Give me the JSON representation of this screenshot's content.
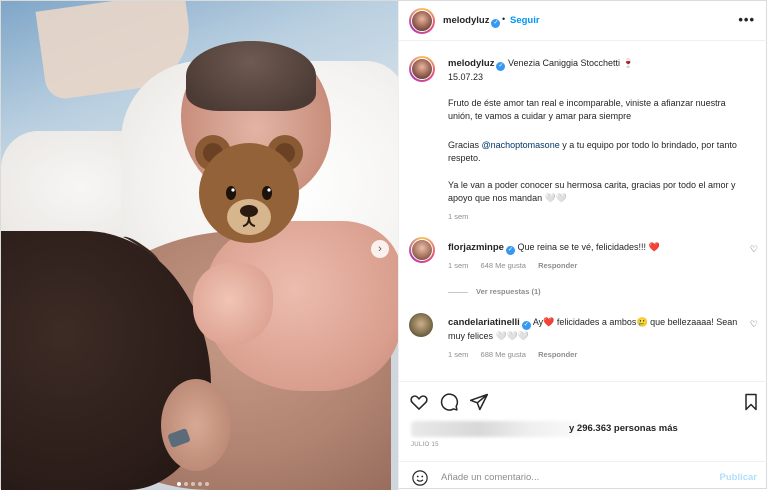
{
  "header": {
    "username": "melodyluz",
    "follow_label": "Seguir",
    "separator": "•",
    "more_label": "•••"
  },
  "caption": {
    "username": "melodyluz",
    "name_suffix": "Venezia Caniggia Stocchetti 🍷",
    "date_line": "15.07.23",
    "para1": "Fruto de éste amor tan real e incomparable, viniste a afianzar nuestra unión, te vamos a cuidar y amar para siempre",
    "para2_pre": "Gracias ",
    "para2_mention": "@nachoptomasone",
    "para2_post": " y a tu equipo por todo lo brindado, por tanto respeto.",
    "para3": "Ya le van a poder conocer su hermosa carita, gracias por todo el amor y apoyo que nos mandan 🤍🤍",
    "time": "1 sem"
  },
  "comments": [
    {
      "username": "florjazminpe",
      "text": "Que reina se te vé, felicidades!!!",
      "emoji": "❤️",
      "time": "1 sem",
      "likes": "648 Me gusta",
      "reply_label": "Responder",
      "view_replies": "Ver respuestas (1)"
    },
    {
      "username": "candelariatinelli",
      "text_pre": "Ay",
      "emoji1": "❤️",
      "text_mid": " felicidades a ambos",
      "emoji2": "🥲",
      "text_post": " que bellezaaaa! Sean muy felices 🤍🤍🤍",
      "time": "1 sem",
      "likes": "688 Me gusta",
      "reply_label": "Responder"
    }
  ],
  "likes_text": "y 296.363 personas más",
  "date_label": "JULIO 15",
  "comment_placeholder": "Añade un comentario...",
  "publish_label": "Publicar",
  "colors": {
    "link_blue": "#0095f6",
    "verified_blue": "#3897f0",
    "like_red": "#ed4956"
  },
  "icons": {
    "bear": "bear-emoji-icon",
    "carousel_next": "chevron-right-icon"
  },
  "carousel": {
    "total": 5,
    "active": 0
  }
}
